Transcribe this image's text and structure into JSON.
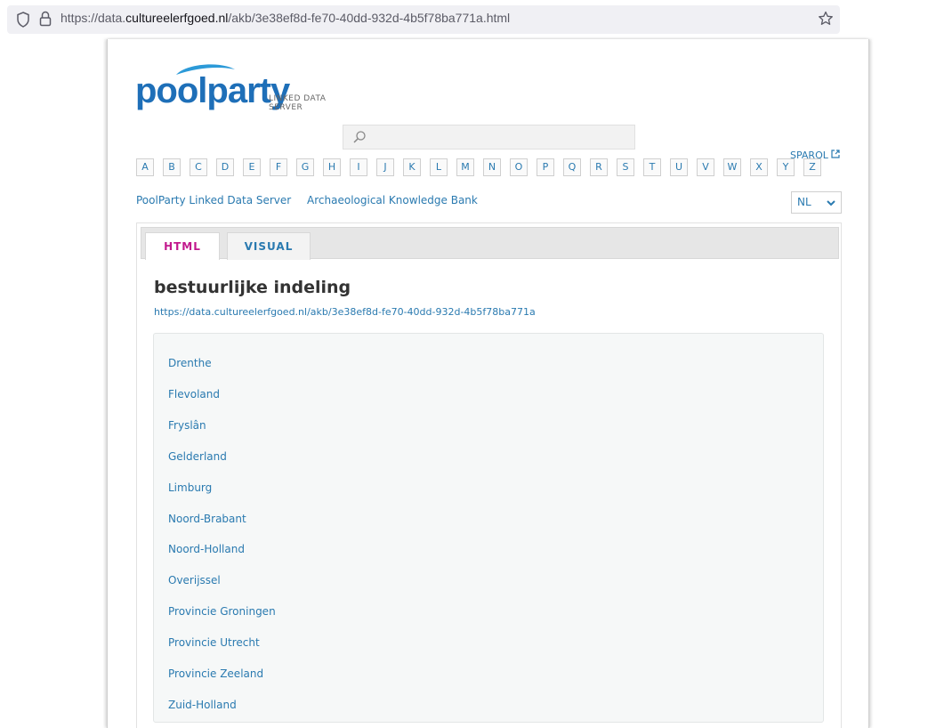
{
  "browser": {
    "url_prefix": "https://data.",
    "url_domain": "cultureelerfgoed.nl",
    "url_path": "/akb/3e38ef8d-fe70-40dd-932d-4b5f78ba771a.html"
  },
  "header": {
    "logo_text": "poolparty",
    "logo_sub": "LINKED DATA SERVER",
    "sparql_label": "SPARQL",
    "alphabet": [
      "A",
      "B",
      "C",
      "D",
      "E",
      "F",
      "G",
      "H",
      "I",
      "J",
      "K",
      "L",
      "M",
      "N",
      "O",
      "P",
      "Q",
      "R",
      "S",
      "T",
      "U",
      "V",
      "W",
      "X",
      "Y",
      "Z"
    ],
    "breadcrumbs": [
      "PoolParty Linked Data Server",
      "Archaeological Knowledge Bank"
    ],
    "language": "NL"
  },
  "tabs": {
    "html": "HTML",
    "visual": "VISUAL"
  },
  "concept": {
    "title": "bestuurlijke indeling",
    "uri": "https://data.cultureelerfgoed.nl/akb/3e38ef8d-fe70-40dd-932d-4b5f78ba771a",
    "items": [
      "Drenthe",
      "Flevoland",
      "Fryslân",
      "Gelderland",
      "Limburg",
      "Noord-Brabant",
      "Noord-Holland",
      "Overijssel",
      "Provincie Groningen",
      "Provincie Utrecht",
      "Provincie Zeeland",
      "Zuid-Holland"
    ]
  },
  "colors": {
    "link": "#2a7ab0",
    "active_tab": "#c2188d",
    "logo": "#1e6fb8"
  }
}
